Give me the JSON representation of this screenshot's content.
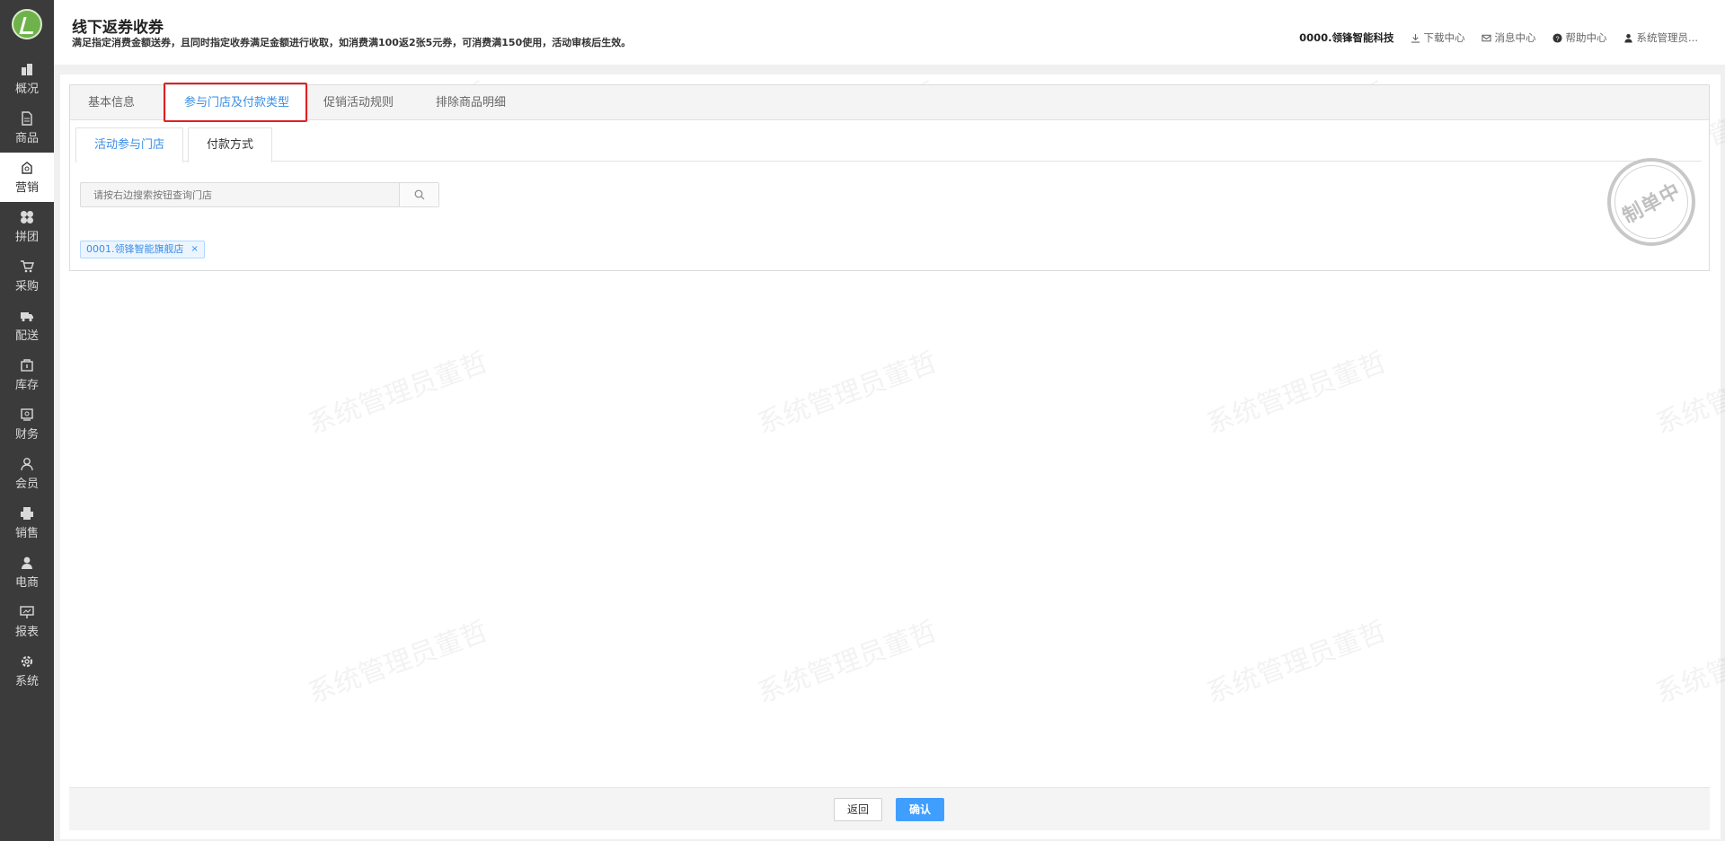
{
  "sidebar": {
    "items": [
      {
        "label": "概况",
        "icon": "building-icon"
      },
      {
        "label": "商品",
        "icon": "document-icon"
      },
      {
        "label": "营销",
        "icon": "marketing-bag-icon",
        "active": true
      },
      {
        "label": "拼团",
        "icon": "group-circles-icon"
      },
      {
        "label": "采购",
        "icon": "cart-icon"
      },
      {
        "label": "配送",
        "icon": "truck-icon"
      },
      {
        "label": "库存",
        "icon": "box-icon"
      },
      {
        "label": "财务",
        "icon": "finance-icon"
      },
      {
        "label": "会员",
        "icon": "user-icon"
      },
      {
        "label": "销售",
        "icon": "printer-icon"
      },
      {
        "label": "电商",
        "icon": "person-filled-icon"
      },
      {
        "label": "报表",
        "icon": "chart-board-icon"
      },
      {
        "label": "系统",
        "icon": "gear-icon"
      }
    ]
  },
  "header": {
    "title": "线下返券收券",
    "description": "满足指定消费金额送券，且同时指定收券满足金额进行收取，如消费满100返2张5元券，可消费满150使用，活动审核后生效。",
    "company": "0000.领锋智能科技",
    "download": "下载中心",
    "messages": "消息中心",
    "help": "帮助中心",
    "user": "系统管理员..."
  },
  "tabs": [
    {
      "label": "基本信息"
    },
    {
      "label": "参与门店及付款类型",
      "active": true
    },
    {
      "label": "促销活动规则"
    },
    {
      "label": "排除商品明细"
    }
  ],
  "subtabs": [
    {
      "label": "活动参与门店",
      "active": true
    },
    {
      "label": "付款方式"
    }
  ],
  "search": {
    "placeholder": "请按右边搜索按钮查询门店"
  },
  "store_tags": [
    {
      "label": "0001.领锋智能旗舰店",
      "close": "×"
    }
  ],
  "stamp": {
    "text": "制单中"
  },
  "watermark": {
    "text": "系统管理员董哲"
  },
  "footer": {
    "back_label": "返回",
    "confirm_label": "确认"
  },
  "colors": {
    "sidebar_bg": "#3b3b3b",
    "accent": "#409eff",
    "highlight": "#e02020",
    "tag_bg": "#ecf5ff"
  }
}
